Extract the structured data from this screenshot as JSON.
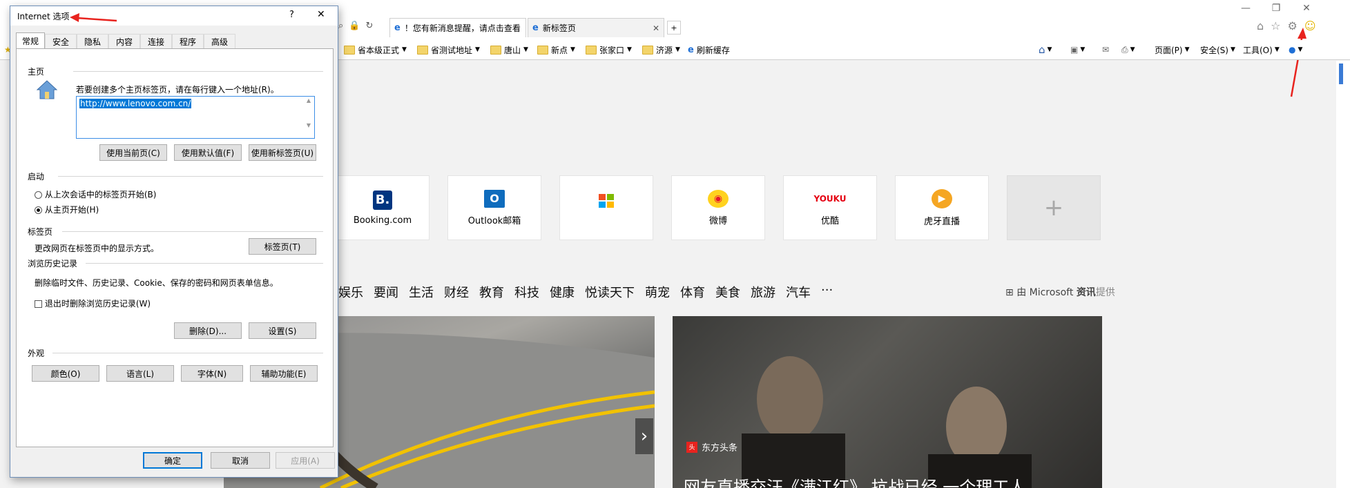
{
  "browser": {
    "tabs": [
      {
        "label": "！您有新消息提醒，请点击查看"
      },
      {
        "label": "新标签页"
      }
    ],
    "bookmarks": [
      {
        "label": "省本级正式"
      },
      {
        "label": "省测试地址"
      },
      {
        "label": "唐山"
      },
      {
        "label": "新点"
      },
      {
        "label": "张家口"
      },
      {
        "label": "济源"
      },
      {
        "label": "刷新缓存"
      }
    ],
    "commands": {
      "page": "页面(P)",
      "safety": "安全(S)",
      "tools": "工具(O)"
    }
  },
  "new_tab_page": {
    "tiles": [
      {
        "label": "Booking.com",
        "icon": "booking-icon",
        "color": "#003580"
      },
      {
        "label": "Outlook邮箱",
        "icon": "outlook-icon",
        "color": "#0f6cbd"
      },
      {
        "label": "",
        "icon": "store-icon"
      },
      {
        "label": "微博",
        "icon": "weibo-icon",
        "color": "#e6162d"
      },
      {
        "label": "优酷",
        "icon": "youku-icon",
        "color": "#e50012"
      },
      {
        "label": "虎牙直播",
        "icon": "huya-icon",
        "color": "#f5a623"
      }
    ],
    "add_tile": "+",
    "categories": [
      "娱乐",
      "要闻",
      "生活",
      "财经",
      "教育",
      "科技",
      "健康",
      "悦读天下",
      "萌宠",
      "体育",
      "美食",
      "旅游",
      "汽车",
      "···"
    ],
    "provider_prefix": "由 Microsoft ",
    "provider_brand": "资讯",
    "provider_suffix": "提供",
    "news_source": "东方头条",
    "news_headline": "网友直播交汪《满江红》 抗战已经 一个理工人"
  },
  "dialog": {
    "title": "Internet 选项",
    "help": "?",
    "close": "✕",
    "tabs": [
      "常规",
      "安全",
      "隐私",
      "内容",
      "连接",
      "程序",
      "高级"
    ],
    "homepage": {
      "label": "主页",
      "hint": "若要创建多个主页标签页，请在每行键入一个地址(R)。",
      "url": "http://www.lenovo.com.cn/",
      "buttons": [
        "使用当前页(C)",
        "使用默认值(F)",
        "使用新标签页(U)"
      ]
    },
    "startup": {
      "label": "启动",
      "options": [
        "从上次会话中的标签页开始(B)",
        "从主页开始(H)"
      ]
    },
    "tabs_group": {
      "label": "标签页",
      "text": "更改网页在标签页中的显示方式。",
      "button": "标签页(T)"
    },
    "history": {
      "label": "浏览历史记录",
      "text": "删除临时文件、历史记录、Cookie、保存的密码和网页表单信息。",
      "checkbox": "退出时删除浏览历史记录(W)",
      "buttons": [
        "删除(D)...",
        "设置(S)"
      ]
    },
    "appearance": {
      "label": "外观",
      "buttons": [
        "颜色(O)",
        "语言(L)",
        "字体(N)",
        "辅助功能(E)"
      ]
    },
    "footer": [
      "确定",
      "取消",
      "应用(A)"
    ]
  },
  "colors": {
    "annotation_arrow": "#e8231e",
    "accent": "#0078d7"
  }
}
